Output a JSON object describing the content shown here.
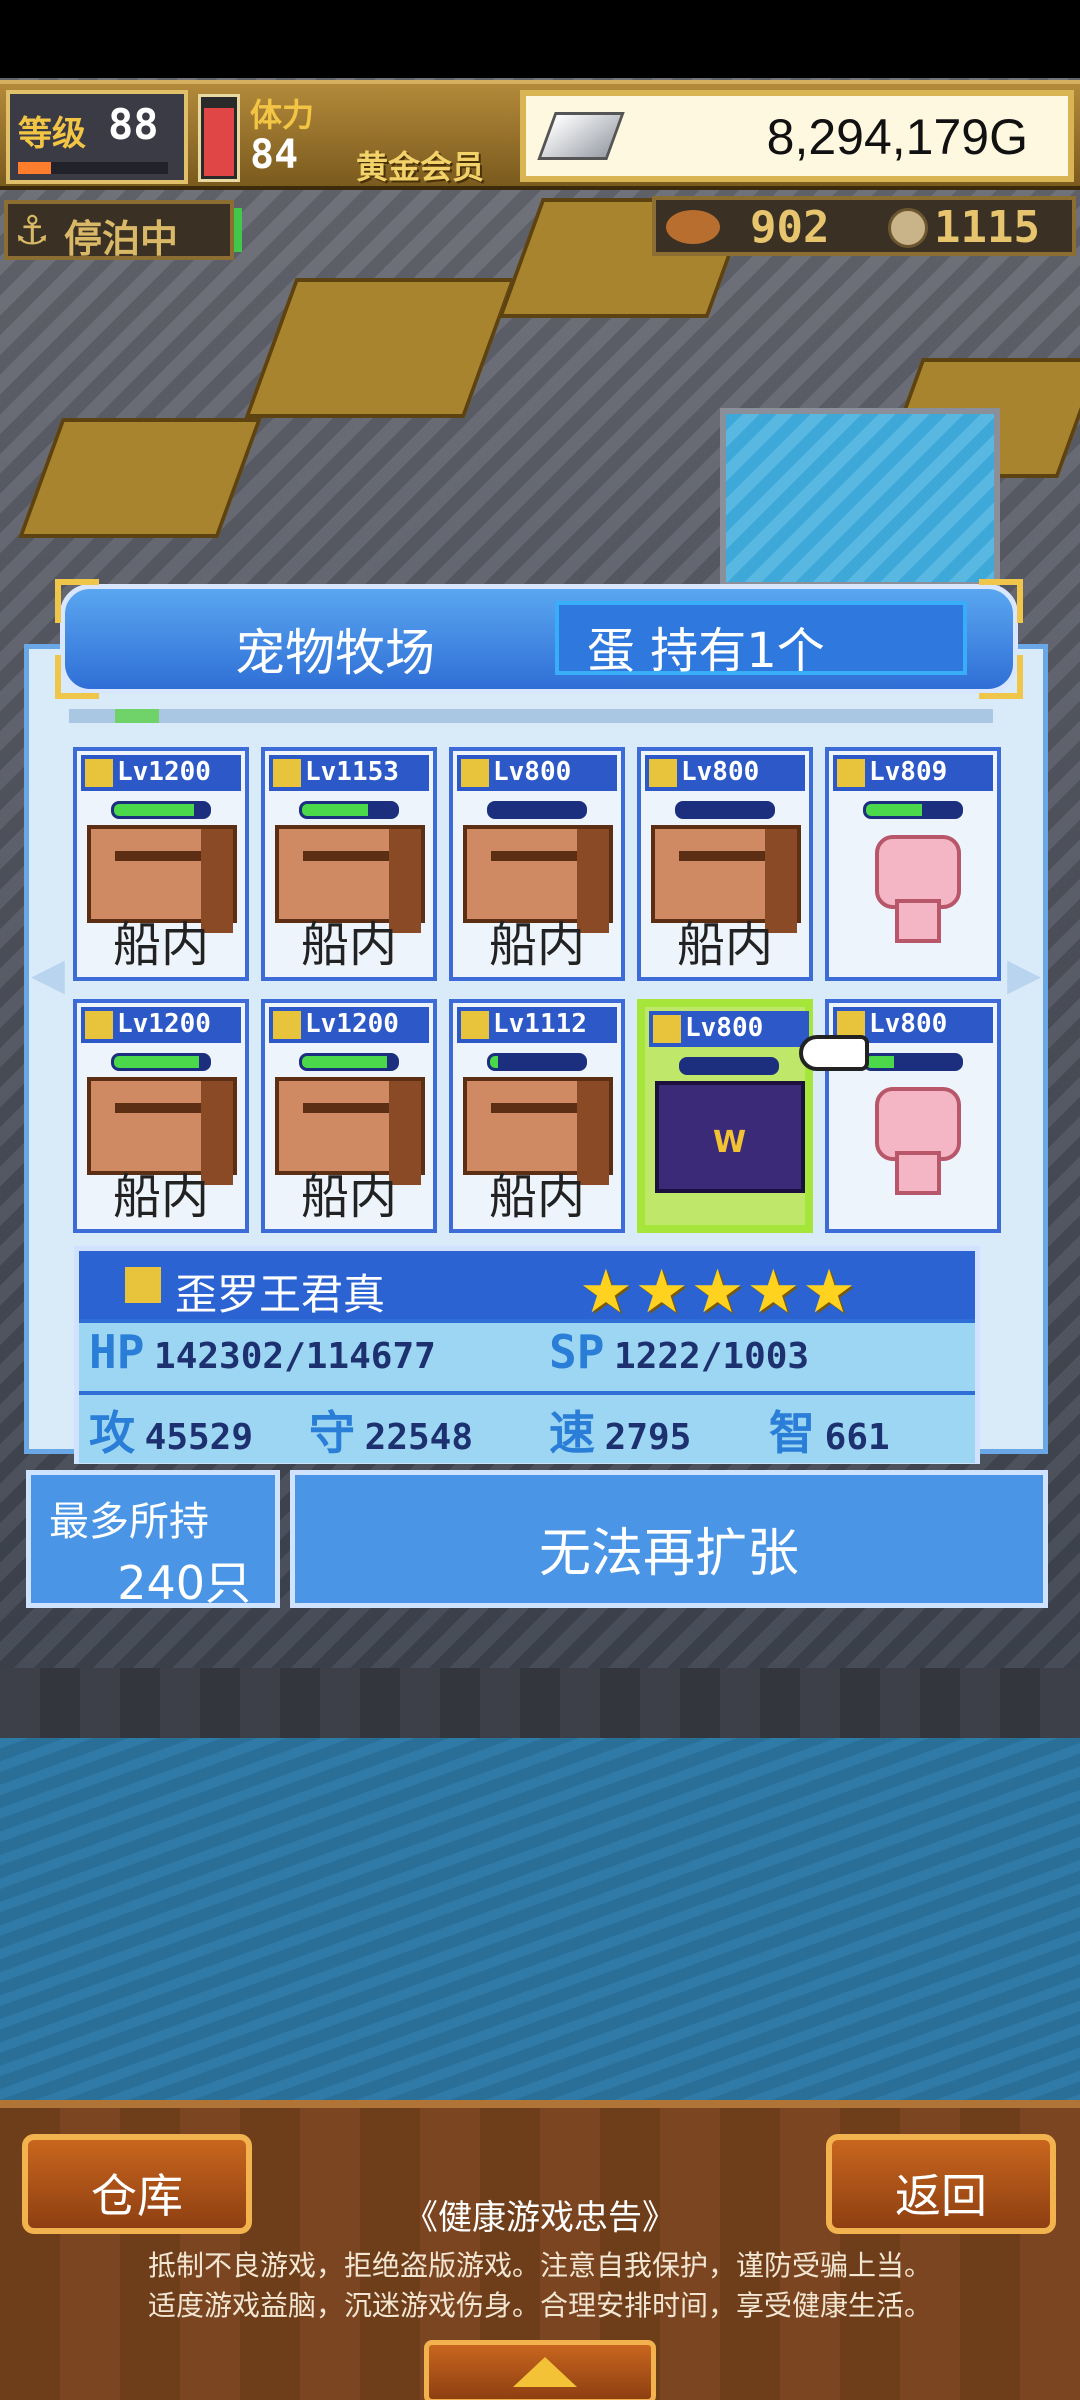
{
  "hud": {
    "level_label": "等级",
    "level_value": "88",
    "level_progress": 0.22,
    "stamina_label": "体力",
    "stamina_value": "84",
    "stamina_fill": 0.9,
    "member_label": "黄金会员",
    "gold_value": "8,294,179G",
    "dock_status": "停泊中",
    "food_count": "902",
    "coin_count": "1115"
  },
  "ranch": {
    "title": "宠物牧场",
    "egg_label": "蛋 持有1个",
    "scroll_position": 0.05,
    "cards": [
      {
        "level": "Lv1200",
        "hp": 0.85,
        "type": "face",
        "location": "船内"
      },
      {
        "level": "Lv1153",
        "hp": 0.7,
        "type": "face",
        "location": "船内"
      },
      {
        "level": "Lv800",
        "hp": 0.0,
        "type": "face",
        "location": "船内"
      },
      {
        "level": "Lv800",
        "hp": 0.0,
        "type": "face",
        "location": "船内"
      },
      {
        "level": "Lv809",
        "hp": 0.6,
        "type": "axolotl",
        "location": ""
      },
      {
        "level": "Lv1200",
        "hp": 0.9,
        "type": "face",
        "location": "船内"
      },
      {
        "level": "Lv1200",
        "hp": 0.9,
        "type": "face",
        "location": "船内"
      },
      {
        "level": "Lv1112",
        "hp": 0.08,
        "type": "face",
        "location": "船内"
      },
      {
        "level": "Lv800",
        "hp": 0.0,
        "type": "knight",
        "location": "",
        "selected": true
      },
      {
        "level": "Lv800",
        "hp": 0.3,
        "type": "axolotl",
        "location": ""
      }
    ],
    "selected": {
      "name": "歪罗王君真",
      "stars": "★★★★★",
      "hp_label": "HP",
      "hp_value": "142302/114677",
      "sp_label": "SP",
      "sp_value": "1222/1003",
      "atk_label": "攻",
      "atk_value": "45529",
      "def_label": "守",
      "def_value": "22548",
      "spd_label": "速",
      "spd_value": "2795",
      "int_label": "智",
      "int_value": "661"
    },
    "capacity_label": "最多所持",
    "capacity_value": "240只",
    "expand_label": "无法再扩张"
  },
  "bottom": {
    "warehouse_label": "仓库",
    "back_label": "返回",
    "notice_title": "《健康游戏忠告》",
    "notice_line1": "抵制不良游戏，拒绝盗版游戏。注意自我保护，谨防受骗上当。",
    "notice_line2": "适度游戏益脑，沉迷游戏伤身。合理安排时间，享受健康生活。"
  }
}
